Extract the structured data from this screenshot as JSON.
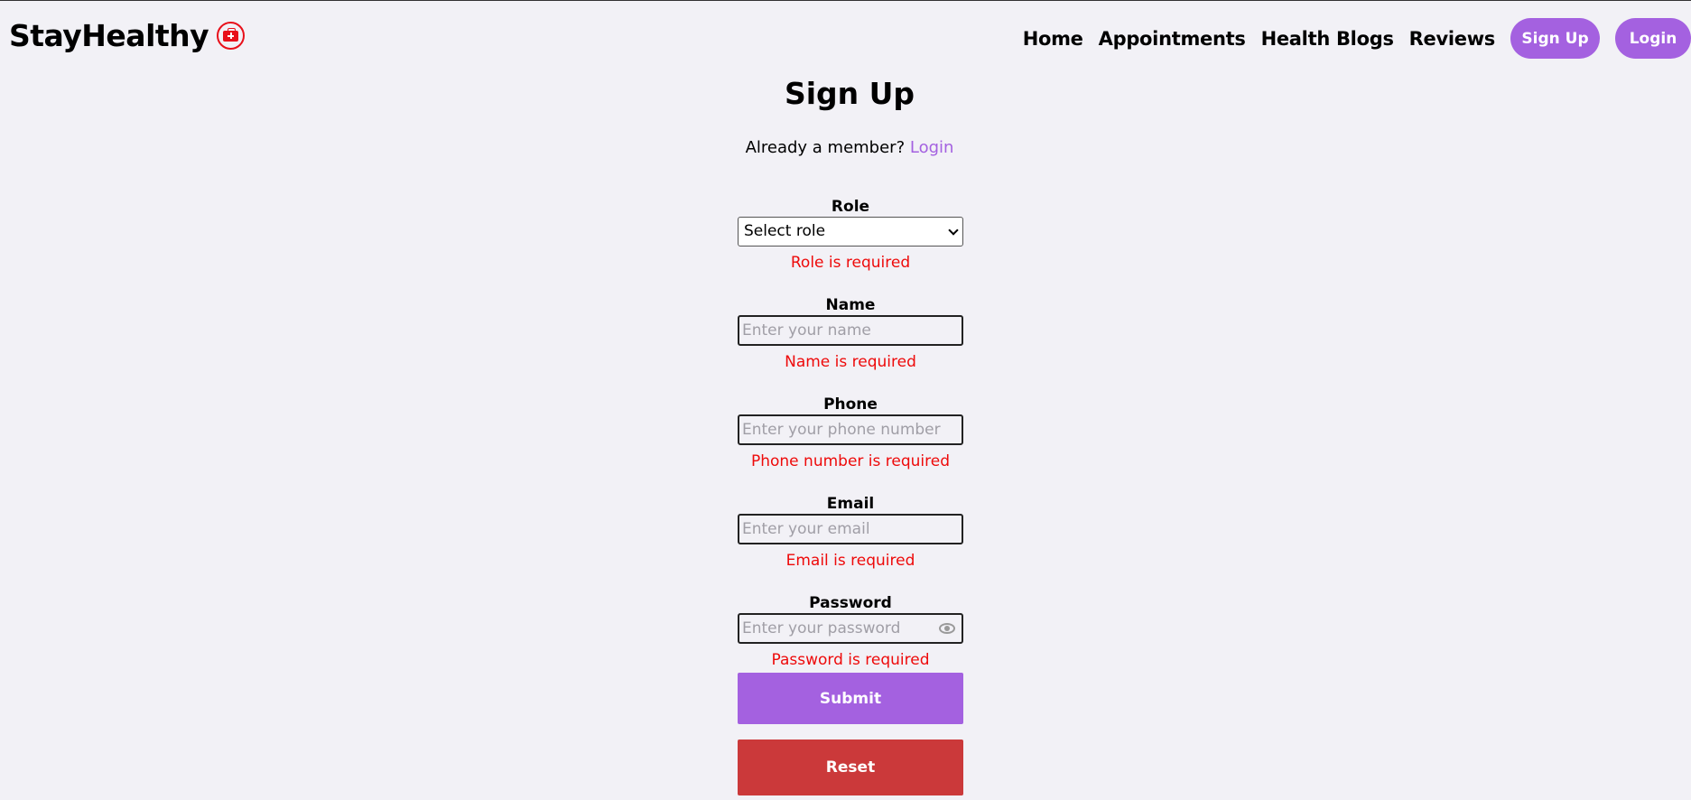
{
  "brand": {
    "name": "StayHealthy",
    "icon": "medical-kit-icon"
  },
  "nav": {
    "links": [
      "Home",
      "Appointments",
      "Health Blogs",
      "Reviews"
    ],
    "signup_label": "Sign Up",
    "login_label": "Login"
  },
  "page": {
    "title": "Sign Up",
    "member_text": "Already a member?",
    "member_link": "Login"
  },
  "form": {
    "role": {
      "label": "Role",
      "value": "Select role",
      "error": "Role is required"
    },
    "name": {
      "label": "Name",
      "placeholder": "Enter your name",
      "error": "Name is required"
    },
    "phone": {
      "label": "Phone",
      "placeholder": "Enter your phone number",
      "error": "Phone number is required"
    },
    "email": {
      "label": "Email",
      "placeholder": "Enter your email",
      "error": "Email is required"
    },
    "password": {
      "label": "Password",
      "placeholder": "Enter your password",
      "error": "Password is required",
      "toggle_icon": "eye-icon"
    },
    "submit_label": "Submit",
    "reset_label": "Reset"
  },
  "colors": {
    "accent": "#a461e0",
    "error": "#ee0a0a",
    "reset": "#cb393a",
    "brand_icon": "#e8101a"
  }
}
